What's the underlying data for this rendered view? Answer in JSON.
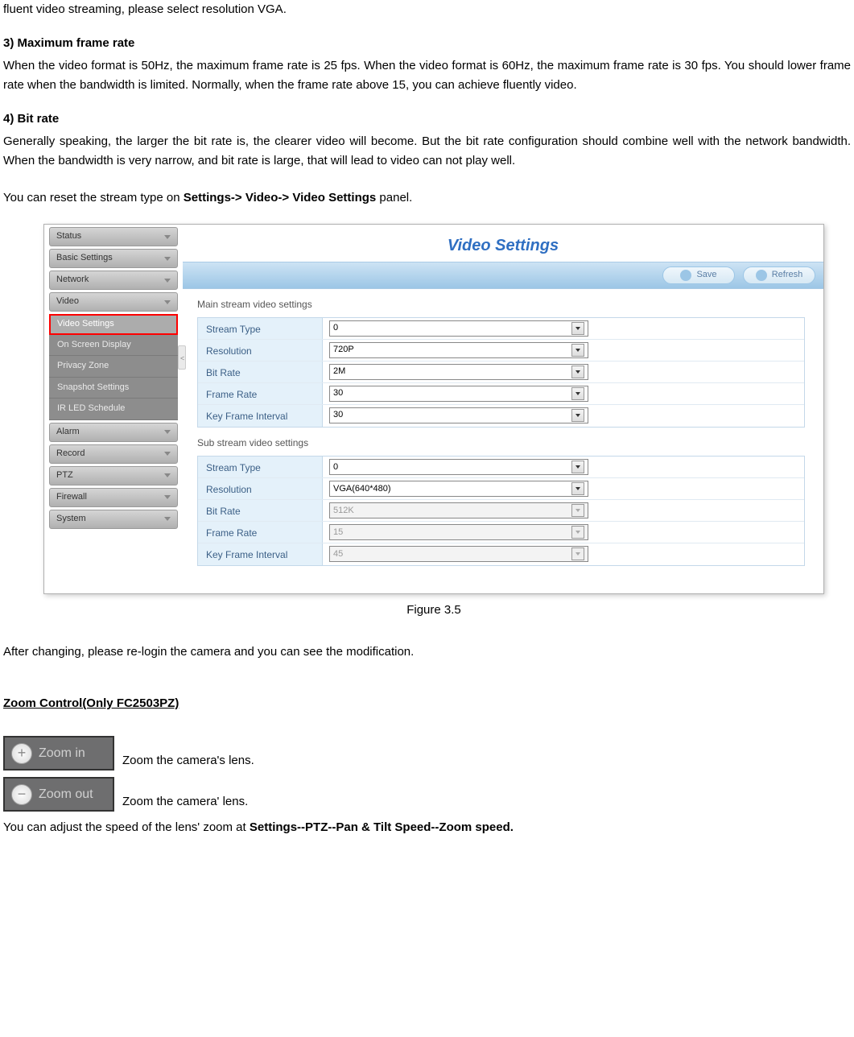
{
  "intro_line": "fluent video streaming, please select resolution VGA.",
  "section3_heading": "3) Maximum frame rate",
  "section3_body": "When the video format is 50Hz, the maximum frame rate is 25 fps. When the video format is 60Hz, the maximum frame rate is 30 fps. You should lower frame rate when the bandwidth is limited. Normally, when the frame rate above 15, you can achieve fluently video.",
  "section4_heading": "4) Bit rate",
  "section4_body": "Generally speaking, the larger the bit rate is, the clearer video will become. But the bit rate configuration should combine well with the network bandwidth. When the bandwidth is very narrow, and bit rate is large, that will lead to video can not play well.",
  "reset_line_prefix": "You can reset the stream type on ",
  "reset_line_bold": "Settings-> Video-> Video Settings",
  "reset_line_suffix": " panel.",
  "figure_caption": "Figure 3.5",
  "after_change_line": "After changing, please re-login the camera and you can see the modification.",
  "zoom_heading": "Zoom Control(Only FC2503PZ)",
  "zoom_in_label": "Zoom in",
  "zoom_in_desc": " Zoom the camera's lens.",
  "zoom_out_label": "Zoom out",
  "zoom_out_desc": " Zoom the camera' lens.",
  "zoom_speed_prefix": "You can adjust the speed of the lens' zoom at ",
  "zoom_speed_bold": "Settings--PTZ--Pan & Tilt Speed--Zoom speed.",
  "settings_panel": {
    "title": "Video Settings",
    "save_btn": "Save",
    "refresh_btn": "Refresh",
    "sidebar": {
      "items": [
        "Status",
        "Basic Settings",
        "Network",
        "Video"
      ],
      "sub_items": [
        "Video Settings",
        "On Screen Display",
        "Privacy Zone",
        "Snapshot Settings",
        "IR LED Schedule"
      ],
      "items2": [
        "Alarm",
        "Record",
        "PTZ",
        "Firewall",
        "System"
      ]
    },
    "main_section_label": "Main stream video settings",
    "sub_section_label": "Sub stream video settings",
    "main_rows": [
      {
        "label": "Stream Type",
        "value": "0",
        "disabled": false
      },
      {
        "label": "Resolution",
        "value": "720P",
        "disabled": false
      },
      {
        "label": "Bit Rate",
        "value": "2M",
        "disabled": false
      },
      {
        "label": "Frame Rate",
        "value": "30",
        "disabled": false
      },
      {
        "label": "Key Frame Interval",
        "value": "30",
        "disabled": false
      }
    ],
    "sub_rows": [
      {
        "label": "Stream Type",
        "value": "0",
        "disabled": false
      },
      {
        "label": "Resolution",
        "value": "VGA(640*480)",
        "disabled": false
      },
      {
        "label": "Bit Rate",
        "value": "512K",
        "disabled": true
      },
      {
        "label": "Frame Rate",
        "value": "15",
        "disabled": true
      },
      {
        "label": "Key Frame Interval",
        "value": "45",
        "disabled": true
      }
    ]
  }
}
